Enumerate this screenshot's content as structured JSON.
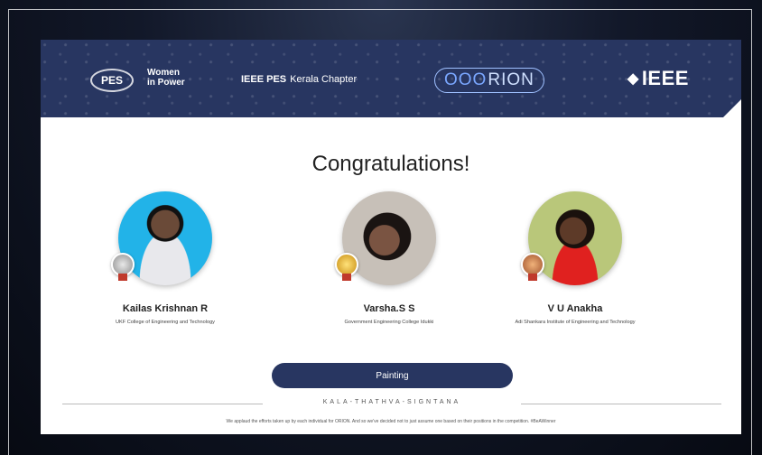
{
  "banner": {
    "pes_logo": "PES",
    "wip_logo_line1": "Women",
    "wip_logo_line2": "in Power",
    "chapter_bold": "IEEE PES",
    "chapter_light": "Kerala Chapter",
    "orion_rings": "OOO",
    "orion_text": "RION",
    "ieee_text": "IEEE",
    "ieee_diamond": "◆"
  },
  "title": "Congratulations!",
  "winners": [
    {
      "name": "Kailas Krishnan R",
      "institution": "UKF College of Engineering and Technology",
      "medal": "silver"
    },
    {
      "name": "Varsha.S S",
      "institution": "Government Engineering College Idukki",
      "medal": "gold"
    },
    {
      "name": "V U Anakha",
      "institution": "Adi Shankara Institute of Engineering and Technology",
      "medal": "bronze"
    }
  ],
  "category": "Painting",
  "motto": "KALA-THATHVA-SIGNTANA",
  "footer": "We applaud the efforts taken up by each individual for ORION. And so we've decided not to just assume one based on their positions in the competition. #BeAWinner"
}
